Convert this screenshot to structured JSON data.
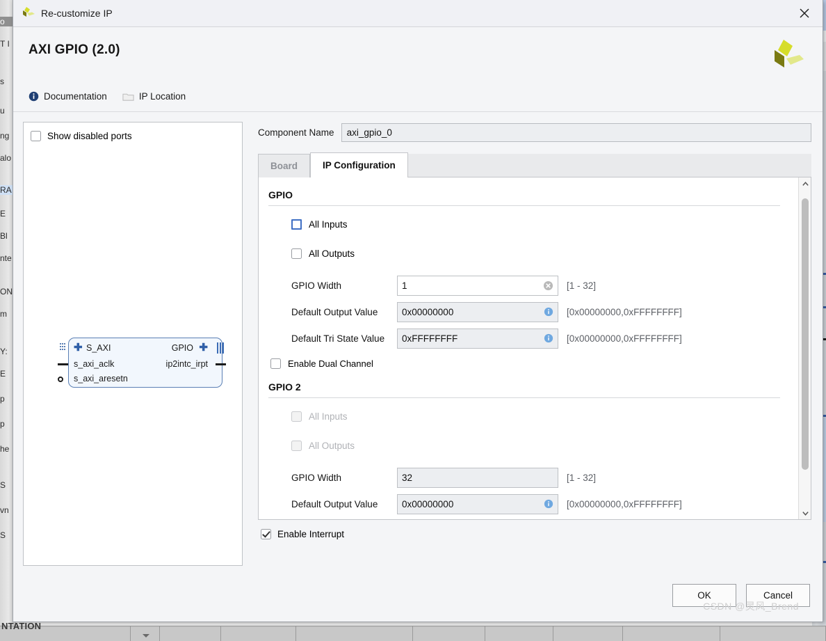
{
  "window": {
    "title": "Re-customize IP",
    "close_icon": "close-icon",
    "logo_icon": "xilinx-logo-icon"
  },
  "header": {
    "ip_title": "AXI GPIO (2.0)",
    "brand_logo_icon": "xilinx-logo-icon",
    "links": [
      {
        "label": "Documentation",
        "icon": "info-circle-icon"
      },
      {
        "label": "IP Location",
        "icon": "folder-icon"
      }
    ]
  },
  "preview": {
    "show_disabled_ports_label": "Show disabled ports",
    "show_disabled_ports_checked": false,
    "block": {
      "left_ports": [
        "S_AXI",
        "s_axi_aclk",
        "s_axi_aresetn"
      ],
      "right_ports": [
        "GPIO",
        "ip2intc_irpt"
      ],
      "expand_icon": "plus-icon"
    }
  },
  "component": {
    "name_label": "Component Name",
    "name_value": "axi_gpio_0"
  },
  "tabs": [
    {
      "label": "Board",
      "active": false
    },
    {
      "label": "IP Configuration",
      "active": true
    }
  ],
  "gpio": {
    "section_title": "GPIO",
    "all_inputs_label": "All Inputs",
    "all_inputs_checked": false,
    "all_outputs_label": "All Outputs",
    "all_outputs_checked": false,
    "width_label": "GPIO Width",
    "width_value": "1",
    "width_range": "[1 - 32]",
    "width_clear_icon": "clear-circle-icon",
    "default_output_label": "Default Output Value",
    "default_output_value": "0x00000000",
    "default_output_range": "[0x00000000,0xFFFFFFFF]",
    "default_output_info_icon": "info-icon",
    "default_tri_label": "Default Tri State Value",
    "default_tri_value": "0xFFFFFFFF",
    "default_tri_range": "[0x00000000,0xFFFFFFFF]",
    "default_tri_info_icon": "info-icon",
    "dual_channel_label": "Enable Dual Channel",
    "dual_channel_checked": false
  },
  "gpio2": {
    "section_title": "GPIO 2",
    "all_inputs_label": "All Inputs",
    "all_inputs_checked": false,
    "all_outputs_label": "All Outputs",
    "all_outputs_checked": false,
    "width_label": "GPIO Width",
    "width_value": "32",
    "width_range": "[1 - 32]",
    "default_output_label": "Default Output Value",
    "default_output_value": "0x00000000",
    "default_output_range": "[0x00000000,0xFFFFFFFF]",
    "default_output_info_icon": "info-icon"
  },
  "interrupt": {
    "label": "Enable Interrupt",
    "checked": true
  },
  "footer": {
    "ok_label": "OK",
    "cancel_label": "Cancel"
  },
  "watermark": {
    "text": "CSDN @灵风_Brend"
  },
  "scrollbar": {
    "up_icon": "chevron-up-icon",
    "down_icon": "chevron-down-icon"
  },
  "background": {
    "bottom_label": "NTATION",
    "left_fragments": [
      "o",
      "T I",
      "s",
      "u",
      "ng",
      "alo",
      "RA",
      "E",
      "Bl",
      "nte",
      "ON",
      "m",
      "Y:",
      "E",
      "p",
      "p",
      "he",
      "S",
      "vn",
      "S"
    ]
  },
  "colors": {
    "accent_blue": "#3f6fc4",
    "info_blue": "#4a86c8",
    "block_border": "#5a7fb4",
    "logo_green": "#c8d400"
  }
}
